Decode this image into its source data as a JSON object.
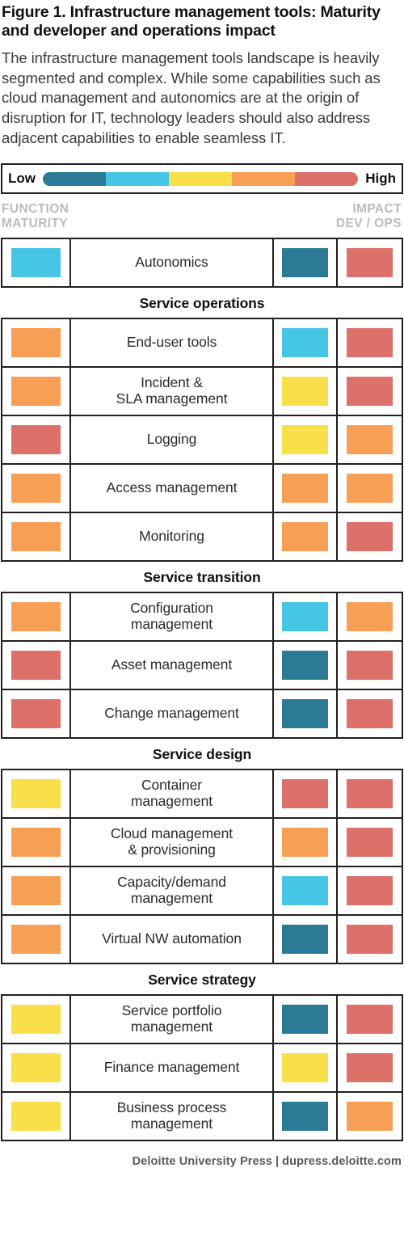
{
  "title": "Figure 1. Infrastructure management tools: Maturity and developer and operations impact",
  "intro": "The infrastructure management tools landscape is heavily segmented and complex. While some capabilities such as cloud management and autonomics are at the origin of disruption for IT, technology leaders should also address adjacent capabilities to enable seamless IT.",
  "legend": {
    "low_label": "Low",
    "high_label": "High",
    "scale": [
      "#2b7b97",
      "#45c6e5",
      "#f9e04b",
      "#f79f54",
      "#dd7068"
    ]
  },
  "column_headers": {
    "left": "FUNCTION\nMATURITY",
    "right_line1": "IMPACT",
    "right_line2": "DEV  /  OPS",
    "right": "IMPACT\nDEV  /  OPS"
  },
  "palette": {
    "teal": "#2b7b97",
    "cyan": "#45c6e5",
    "yellow": "#f9e04b",
    "orange": "#f79f54",
    "salmon": "#dd7068",
    "border": "#231f20",
    "header_gray": "#bcbcbc"
  },
  "chart_data": {
    "type": "heatmap",
    "title": "Figure 1. Infrastructure management tools: Maturity and developer and operations impact",
    "scale_labels": [
      "Low",
      "High"
    ],
    "scale_colors": [
      "#2b7b97",
      "#45c6e5",
      "#f9e04b",
      "#f79f54",
      "#dd7068"
    ],
    "columns": [
      "Function maturity",
      "Function",
      "Impact DEV",
      "Impact OPS"
    ],
    "groups": [
      {
        "name": "",
        "rows": [
          {
            "label": "Autonomics",
            "maturity": "#45c6e5",
            "dev": "#2b7b97",
            "ops": "#dd7068"
          }
        ]
      },
      {
        "name": "Service  operations",
        "rows": [
          {
            "label": "End-user tools",
            "maturity": "#f79f54",
            "dev": "#45c6e5",
            "ops": "#dd7068"
          },
          {
            "label": "Incident &\nSLA management",
            "maturity": "#f79f54",
            "dev": "#f9e04b",
            "ops": "#dd7068"
          },
          {
            "label": "Logging",
            "maturity": "#dd7068",
            "dev": "#f9e04b",
            "ops": "#f79f54"
          },
          {
            "label": "Access management",
            "maturity": "#f79f54",
            "dev": "#f79f54",
            "ops": "#f79f54"
          },
          {
            "label": "Monitoring",
            "maturity": "#f79f54",
            "dev": "#f79f54",
            "ops": "#dd7068"
          }
        ]
      },
      {
        "name": "Service transition",
        "rows": [
          {
            "label": "Configuration\nmanagement",
            "maturity": "#f79f54",
            "dev": "#45c6e5",
            "ops": "#f79f54"
          },
          {
            "label": "Asset management",
            "maturity": "#dd7068",
            "dev": "#2b7b97",
            "ops": "#dd7068"
          },
          {
            "label": "Change management",
            "maturity": "#dd7068",
            "dev": "#2b7b97",
            "ops": "#dd7068"
          }
        ]
      },
      {
        "name": "Service design",
        "rows": [
          {
            "label": "Container\nmanagement",
            "maturity": "#f9e04b",
            "dev": "#dd7068",
            "ops": "#dd7068"
          },
          {
            "label": "Cloud management\n& provisioning",
            "maturity": "#f79f54",
            "dev": "#f79f54",
            "ops": "#dd7068"
          },
          {
            "label": "Capacity/demand\nmanagement",
            "maturity": "#f79f54",
            "dev": "#45c6e5",
            "ops": "#dd7068"
          },
          {
            "label": "Virtual NW automation",
            "maturity": "#f79f54",
            "dev": "#2b7b97",
            "ops": "#dd7068"
          }
        ]
      },
      {
        "name": "Service strategy",
        "rows": [
          {
            "label": "Service portfolio\nmanagement",
            "maturity": "#f9e04b",
            "dev": "#2b7b97",
            "ops": "#dd7068"
          },
          {
            "label": "Finance management",
            "maturity": "#f9e04b",
            "dev": "#f9e04b",
            "ops": "#dd7068"
          },
          {
            "label": "Business process\nmanagement",
            "maturity": "#f9e04b",
            "dev": "#2b7b97",
            "ops": "#f79f54"
          }
        ]
      }
    ]
  },
  "footer": {
    "publisher": "Deloitte University Press",
    "separator": "|",
    "url": "dupress.deloitte.com"
  }
}
